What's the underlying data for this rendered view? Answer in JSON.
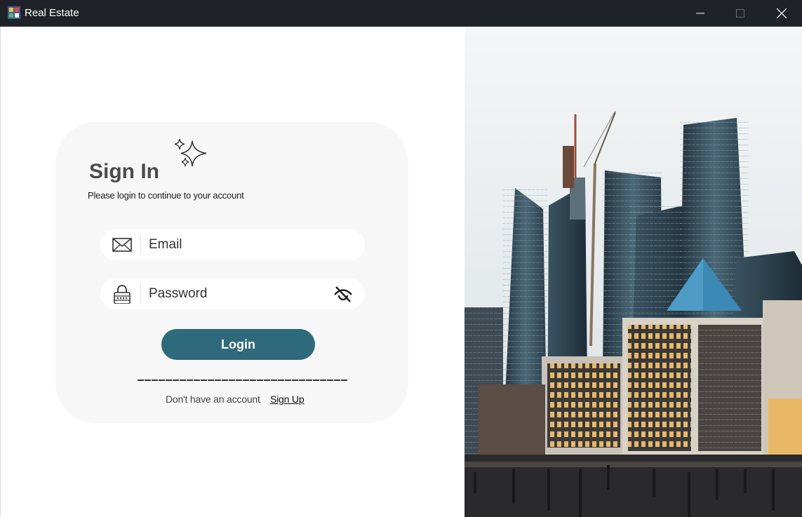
{
  "window": {
    "title": "Real Estate"
  },
  "signin": {
    "title": "Sign In",
    "subtitle": "Please login to continue to your account"
  },
  "email": {
    "placeholder": "Email",
    "value": ""
  },
  "password": {
    "placeholder": "Password",
    "value": ""
  },
  "login": {
    "label": "Login"
  },
  "signup": {
    "prompt": "Don't have an account",
    "link": "Sign Up"
  },
  "icons": {
    "app": "app-icon",
    "minimize": "minimize-icon",
    "maximize": "maximize-icon",
    "close": "close-icon",
    "sparkle": "sparkle-icon",
    "email": "envelope-icon",
    "password": "lock-icon",
    "visibility": "eye-off-icon"
  },
  "colors": {
    "titlebar": "#1f2328",
    "card": "#f7f7f7",
    "accent": "#2e6a7b",
    "title_text": "#4b4b4b"
  }
}
